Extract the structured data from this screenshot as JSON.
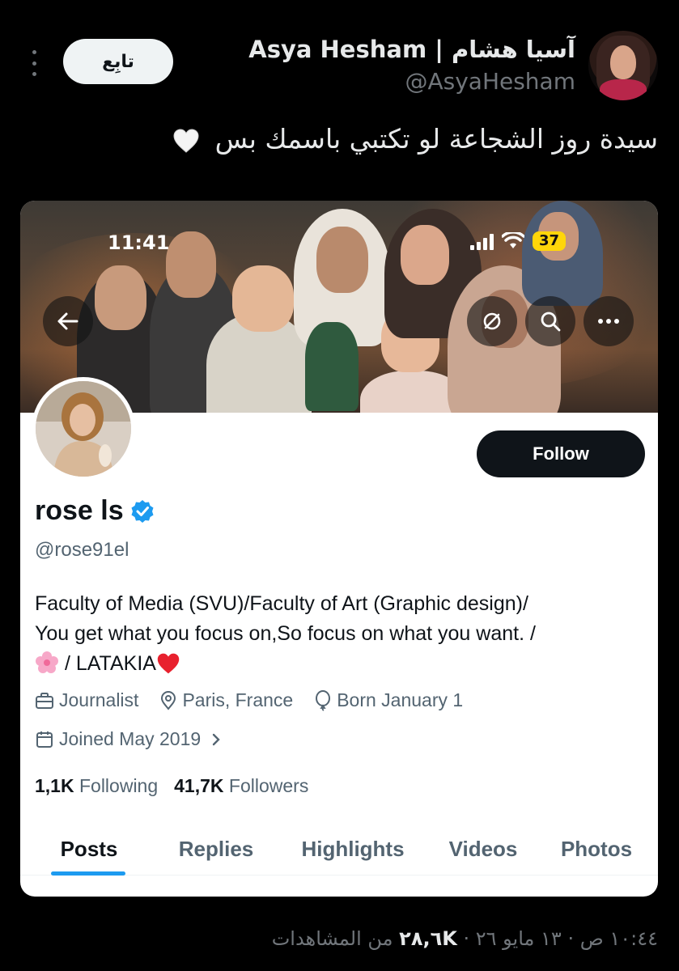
{
  "tweet": {
    "author_name": "Asya Hesham | آسيا هشام",
    "author_handle": "@AsyaHesham",
    "follow_label": "تابِع",
    "text": "سيدة روز الشجاعة لو تكتبي باسمك بس",
    "emoji": "white-heart",
    "footer": {
      "time_date": "١٠:٤٤ ص · ١٣ مايو ٢٦ · ",
      "views_count": "٢٨,٦K",
      "views_label": " من المشاهدات"
    }
  },
  "embedded_profile": {
    "status_bar": {
      "time": "11:41",
      "battery": "37"
    },
    "header_icons": [
      "back-arrow-icon",
      "grok-icon",
      "search-icon",
      "more-icon"
    ],
    "follow_label": "Follow",
    "display_name": "rose ls",
    "verified": true,
    "handle": "@rose91el",
    "bio": {
      "line1": "Faculty of Media (SVU)/Faculty of Art (Graphic design)/",
      "line2": "You get what you focus on,So focus on what you want. /",
      "line3": " / LATAKIA"
    },
    "meta": {
      "profession": "Journalist",
      "location": "Paris, France",
      "birthday": "Born January 1",
      "joined": "Joined May 2019"
    },
    "stats": {
      "following_count": "1,1K",
      "following_label": "Following",
      "followers_count": "41,7K",
      "followers_label": "Followers"
    },
    "tabs": [
      "Posts",
      "Replies",
      "Highlights",
      "Videos",
      "Photos"
    ],
    "active_tab": "Posts",
    "accent_color": "#1d9bf0"
  }
}
